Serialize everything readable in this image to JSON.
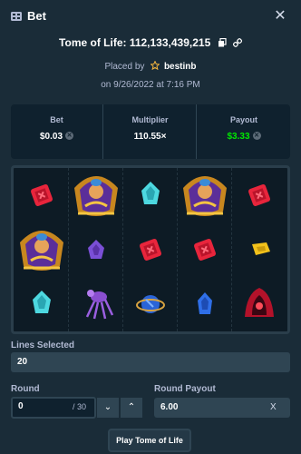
{
  "header": {
    "title": "Bet",
    "icon": "ticket-icon",
    "close_icon": "close-icon",
    "close_glyph": "✕"
  },
  "game": {
    "name_line": "Tome of Life: 112,133,439,215",
    "copy_icon": "copy-icon",
    "link_icon": "link-icon"
  },
  "placed": {
    "prefix": "Placed by",
    "user": "bestinb",
    "user_icon": "star-icon"
  },
  "date": "on 9/26/2022 at 7:16 PM",
  "stats": {
    "bet_label": "Bet",
    "bet_value": "$0.03",
    "multiplier_label": "Multiplier",
    "multiplier_value": "110.55×",
    "payout_label": "Payout",
    "payout_value": "$3.33",
    "payout_color": "#00e701"
  },
  "board": {
    "columns": [
      [
        "red-gem",
        "",
        "cyan-gem"
      ],
      [
        "wild-priestess",
        "",
        "spider-creature"
      ],
      [
        "cyan-gem",
        "red-gem",
        "blue-orb"
      ],
      [
        "wild-priestess",
        "red-gem",
        "blue-gem"
      ],
      [
        "red-gem",
        "yellow-gem",
        "red-hood"
      ]
    ],
    "tall_wild": {
      "column": 0,
      "label": "wild-priestess"
    }
  },
  "lines": {
    "label": "Lines Selected",
    "value": "20"
  },
  "round": {
    "label": "Round",
    "value": "0",
    "suffix": "/ 30",
    "down_glyph": "⌄",
    "up_glyph": "⌃"
  },
  "round_payout": {
    "label": "Round Payout",
    "value": "6.00",
    "clear_glyph": "X"
  },
  "play_button": "Play Tome of Life"
}
